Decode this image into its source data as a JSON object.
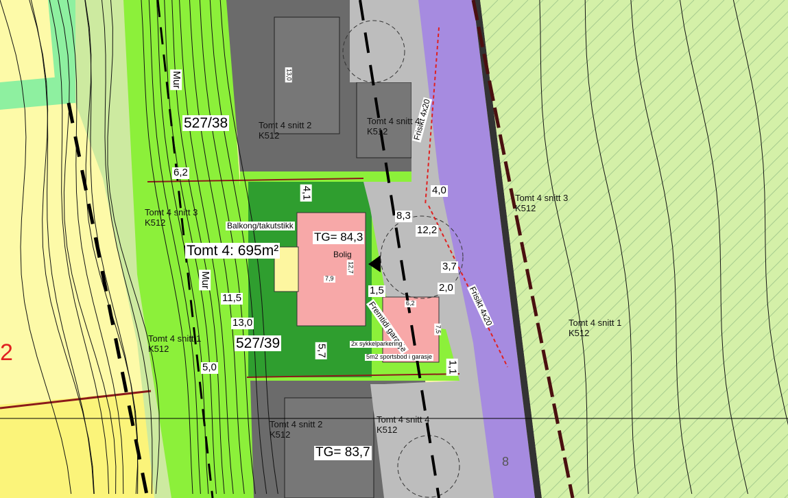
{
  "colors": {
    "yellow": "#fdfaa8",
    "yellow_strong": "#fbf47a",
    "light_green": "#cdeaa0",
    "bright_green": "#8cf03a",
    "dark_green": "#2f9e2f",
    "building_grey": "#6b6b6b",
    "road_grey": "#bdbdbd",
    "purple": "#a68be0",
    "house_pink": "#f7a8a8",
    "red_line": "#e02020"
  },
  "plots": {
    "north": "527/38",
    "main": "527/39",
    "area": "Tomt 4: 695m²",
    "zone_fragment": "2"
  },
  "labels": {
    "mur_top": "Mur",
    "mur_mid": "Mur",
    "balcony": "Balkong/takutstikk",
    "tg_main": "TG= 84,3",
    "tg_south": "TG= 83,7",
    "bolig": "Bolig",
    "garage": "Fremtidi garasje",
    "bike": "2x sykkelparkering",
    "storage": "5m2 sportsbod i garasje",
    "frisikt_top": "Frisikt 4x20",
    "frisikt_mid": "Frisikt 4x20",
    "road_mark": "8"
  },
  "sections": [
    {
      "name": "Tomt 4 snitt 2",
      "code": "K512"
    },
    {
      "name": "Tomt 4 snitt 4",
      "code": "K512"
    },
    {
      "name": "Tomt 4 snitt 3",
      "code": "K512"
    },
    {
      "name": "Tomt 4 snitt 3",
      "code": "K512"
    },
    {
      "name": "Tomt 4 snitt 1",
      "code": "K512"
    },
    {
      "name": "Tomt 4 snitt 1",
      "code": "K512"
    },
    {
      "name": "Tomt 4 snitt 2",
      "code": "K512"
    },
    {
      "name": "Tomt 4 snitt 4",
      "code": "K512"
    }
  ],
  "dimensions": {
    "d13_0_top": "13,0",
    "d6_2": "6,2",
    "d4_1": "4,1",
    "d8_3": "8,3",
    "d4_0": "4,0",
    "d12_2": "12,2",
    "d12_7": "12,7",
    "d7_9": "7,9",
    "d3_7": "3,7",
    "d1_5": "1,5",
    "d2_0": "2,0",
    "d6_2_garage": "6,2",
    "d7_5": "7,5",
    "d11_5": "11,5",
    "d13_0": "13,0",
    "d5_7": "5,7",
    "d5_0": "5,0",
    "d1_1": "1,1"
  }
}
